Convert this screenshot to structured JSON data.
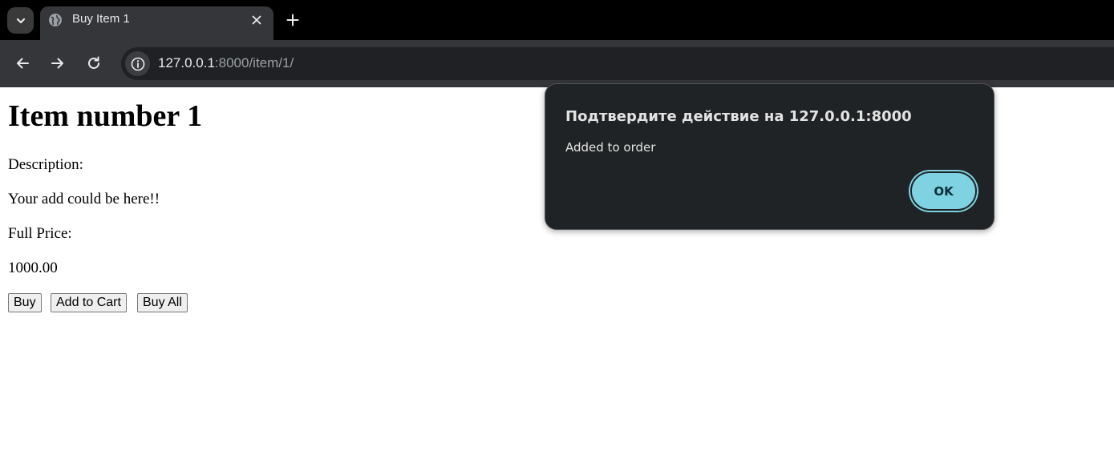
{
  "browser": {
    "tab_title": "Buy Item 1",
    "url_host": "127.0.0.1",
    "url_rest": ":8000/item/1/",
    "tab_search_icon": "chevron-down-icon",
    "favicon_icon": "globe-icon",
    "close_icon": "close-icon",
    "new_tab_icon": "plus-icon",
    "back_icon": "arrow-left-icon",
    "forward_icon": "arrow-right-icon",
    "reload_icon": "reload-icon",
    "site_info_icon": "info-icon"
  },
  "page": {
    "heading": "Item number 1",
    "description_label": "Description:",
    "description_text": "Your add could be here!!",
    "price_label": "Full Price:",
    "price_value": "1000.00",
    "buttons": {
      "buy": "Buy",
      "add_to_cart": "Add to Cart",
      "buy_all": "Buy All"
    }
  },
  "dialog": {
    "title": "Подтвердите действие на 127.0.0.1:8000",
    "message": "Added to order",
    "ok_label": "OK"
  },
  "colors": {
    "chrome_dark": "#000000",
    "toolbar": "#35363a",
    "dialog_bg": "#1f2325",
    "accent": "#7ed2e1"
  }
}
